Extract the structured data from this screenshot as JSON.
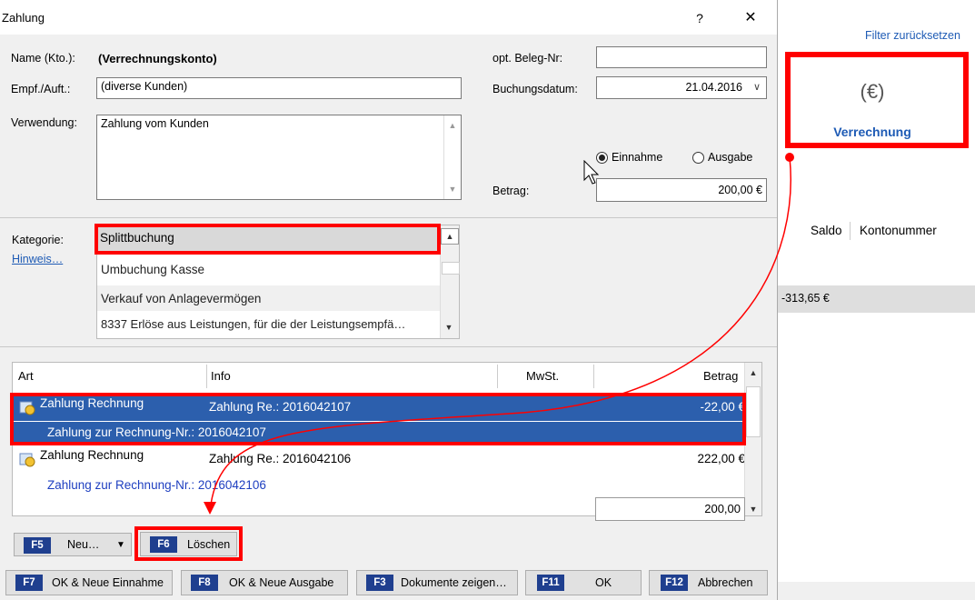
{
  "background": {
    "filter_reset": "Filter zurücksetzen",
    "verrechnung_label": "Verrechnung",
    "verrechnung_icon": "(€)",
    "col_saldo": "Saldo",
    "col_kontonummer": "Kontonummer",
    "row_value": "-313,65 €"
  },
  "dialog": {
    "title": "Zahlung",
    "help": "?",
    "close": "✕",
    "name_label": "Name (Kto.):",
    "name_value": "(Verrechnungskonto)",
    "empf_label": "Empf./Auft.:",
    "empf_value": "(diverse Kunden)",
    "verwendung_label": "Verwendung:",
    "verwendung_value": "Zahlung vom Kunden",
    "beleg_label": "opt. Beleg-Nr:",
    "beleg_value": "",
    "datum_label": "Buchungsdatum:",
    "datum_value": "21.04.2016",
    "radio_einnahme": "Einnahme",
    "radio_ausgabe": "Ausgabe",
    "betrag_label": "Betrag:",
    "betrag_value": "200,00 €",
    "kategorie_label": "Kategorie:",
    "hinweis_link": "Hinweis…",
    "kategorie_items": [
      "Splittbuchung",
      "Umbuchung Kasse",
      "Verkauf von Anlagevermögen",
      "8337 Erlöse aus Leistungen, für die der Leistungsempfä…"
    ]
  },
  "table": {
    "headers": {
      "art": "Art",
      "info": "Info",
      "mwst": "MwSt.",
      "betrag": "Betrag"
    },
    "rows": [
      {
        "art": "Zahlung Rechnung",
        "info": "Zahlung Re.: 2016042107",
        "betrag": "-22,00 €",
        "sub": "Zahlung zur Rechnung-Nr.: 2016042107"
      },
      {
        "art": "Zahlung Rechnung",
        "info": "Zahlung Re.: 2016042106",
        "betrag": "222,00 €",
        "sub": "Zahlung zur Rechnung-Nr.: 2016042106"
      }
    ],
    "sum": "200,00"
  },
  "buttons": {
    "neu": {
      "key": "F5",
      "label": "Neu…"
    },
    "loeschen": {
      "key": "F6",
      "label": "Löschen"
    },
    "ok_neue_einnahme": {
      "key": "F7",
      "label": "OK & Neue Einnahme"
    },
    "ok_neue_ausgabe": {
      "key": "F8",
      "label": "OK & Neue Ausgabe"
    },
    "dokumente": {
      "key": "F3",
      "label": "Dokumente zeigen…"
    },
    "ok": {
      "key": "F11",
      "label": "OK"
    },
    "abbrechen": {
      "key": "F12",
      "label": "Abbrechen"
    }
  },
  "colors": {
    "accent": "#1e5bb5",
    "selection": "#2c5fad",
    "highlight": "#ff0000",
    "fkey": "#1f3f8f"
  }
}
